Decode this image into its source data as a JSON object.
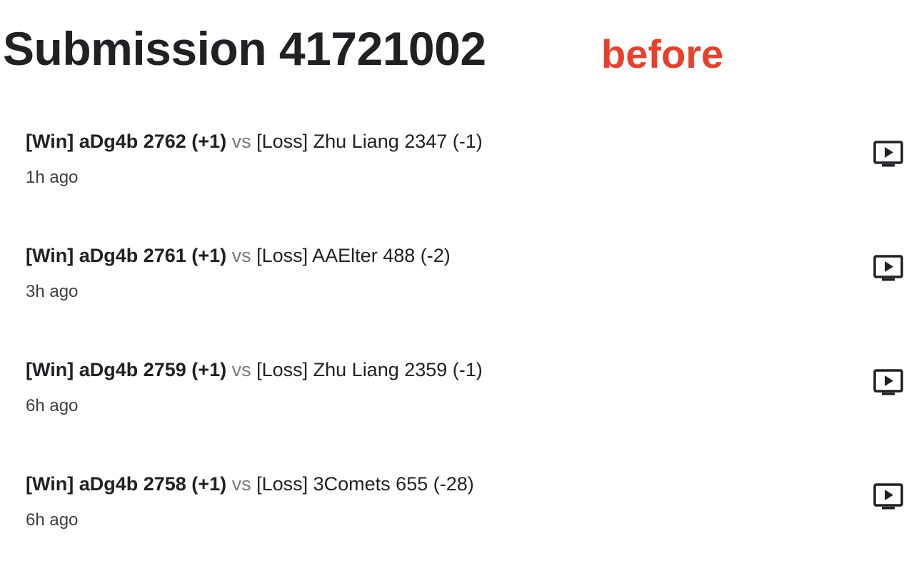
{
  "header": {
    "title": "Submission 41721002",
    "tag": "before"
  },
  "episodes": [
    {
      "winner": "[Win] aDg4b 2762 (+1)",
      "vs": "vs",
      "loser": "[Loss] Zhu Liang 2347 (-1)",
      "time": "1h ago",
      "icon": "replay-icon"
    },
    {
      "winner": "[Win] aDg4b 2761 (+1)",
      "vs": "vs",
      "loser": "[Loss] AAElter 488 (-2)",
      "time": "3h ago",
      "icon": "replay-icon"
    },
    {
      "winner": "[Win] aDg4b 2759 (+1)",
      "vs": "vs",
      "loser": "[Loss] Zhu Liang 2359 (-1)",
      "time": "6h ago",
      "icon": "replay-icon"
    },
    {
      "winner": "[Win] aDg4b 2758 (+1)",
      "vs": "vs",
      "loser": "[Loss] 3Comets 655 (-28)",
      "time": "6h ago",
      "icon": "replay-icon"
    }
  ],
  "colors": {
    "text": "#202124",
    "muted": "#7a7a7a",
    "tag": "#e8402a"
  }
}
